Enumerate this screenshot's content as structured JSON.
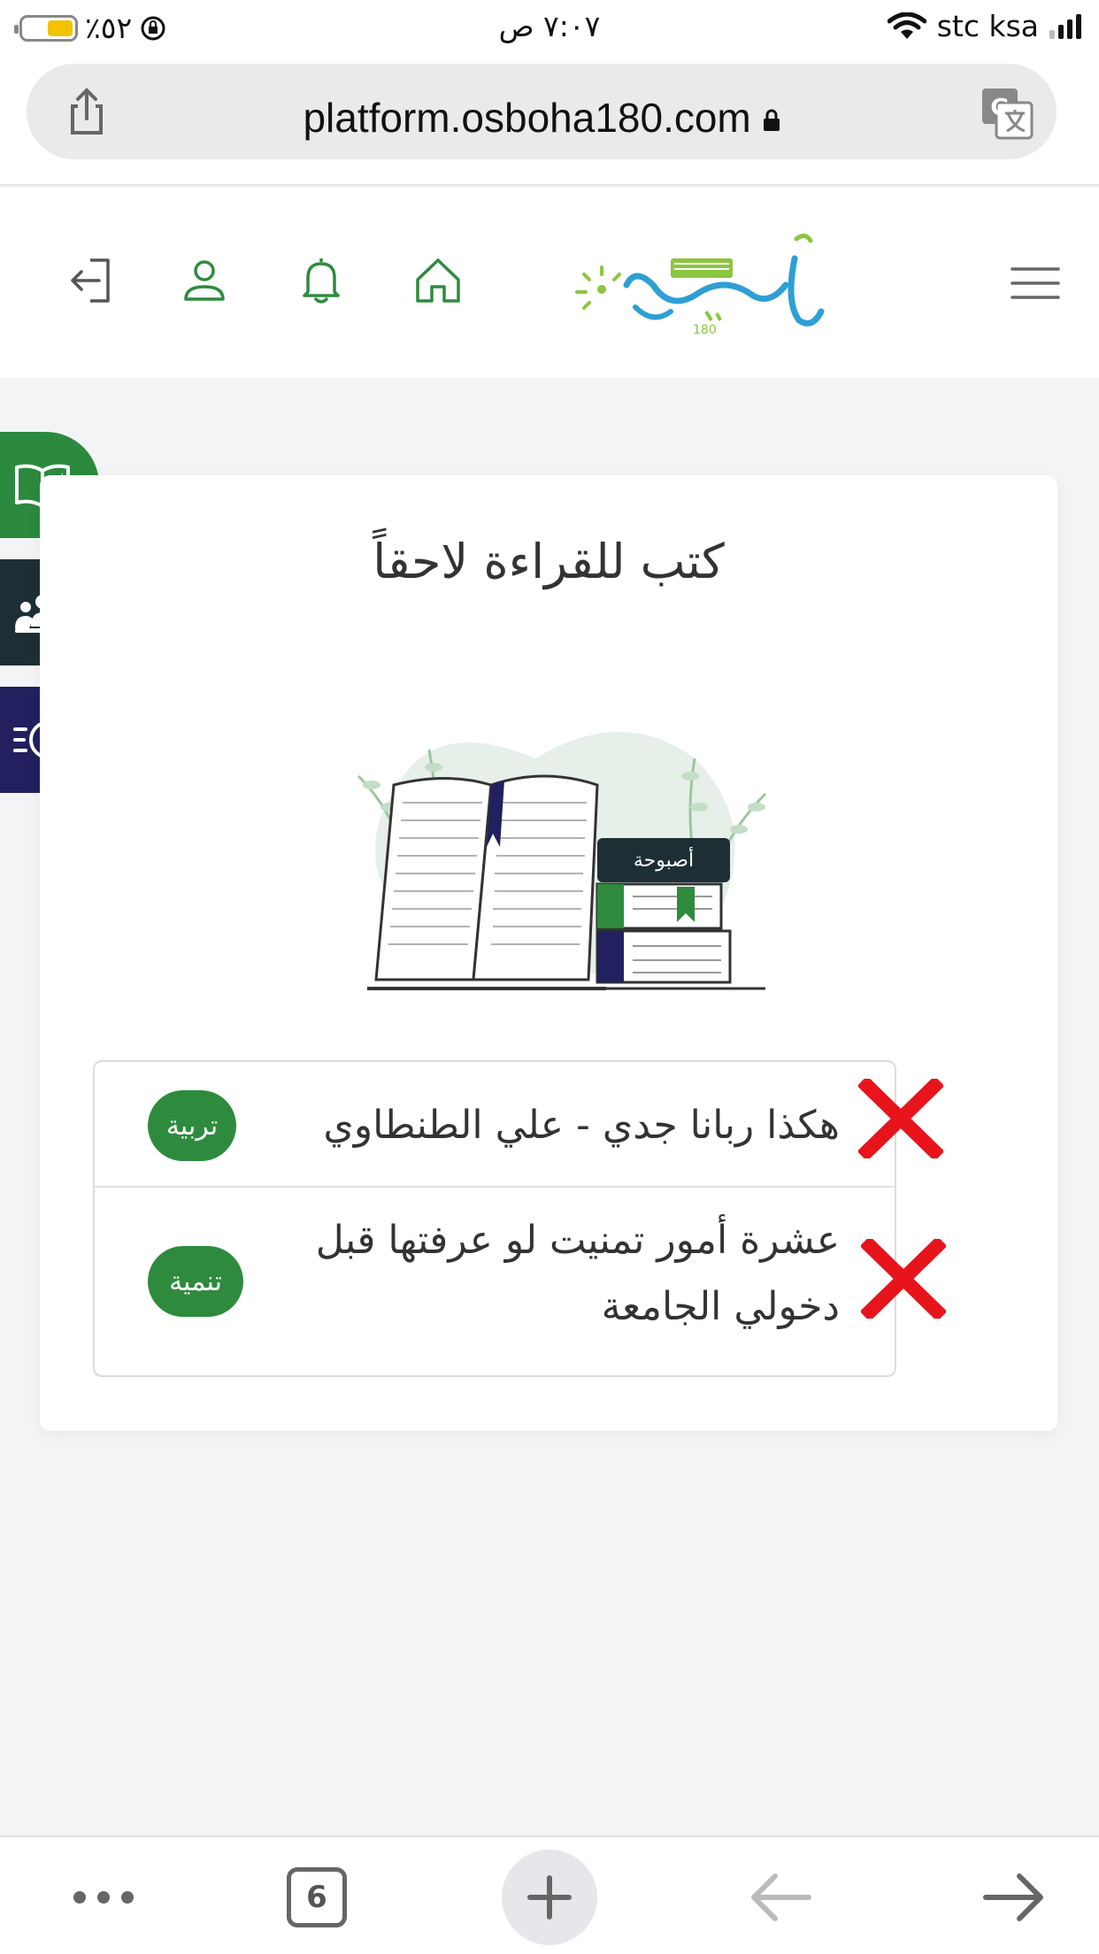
{
  "status_bar": {
    "battery": "٪٥٢",
    "time": "٧:٠٧ ص",
    "carrier": "stc ksa"
  },
  "browser": {
    "url": "platform.osboha180.com",
    "open_tabs": "6"
  },
  "app": {
    "logo_text": "أصبوحة"
  },
  "card": {
    "title": "كتب للقراءة لاحقاً",
    "books": [
      {
        "title": "هكذا ربانا جدي - علي الطنطاوي",
        "category": "تربية"
      },
      {
        "title_line1": "عشرة أمور تمنيت لو عرفتها قبل",
        "title_line2": "دخولي الجامعة",
        "category": "تنمية"
      }
    ]
  },
  "colors": {
    "brand_green": "#2e8b3d",
    "side_green": "#2b8a3e",
    "side_dark": "#1d2f35",
    "side_navy": "#22205e",
    "remove_red": "#e8141b"
  },
  "icons": {
    "header": [
      "logout-icon",
      "user-icon",
      "bell-icon",
      "home-icon",
      "menu-icon"
    ],
    "side": [
      "book-icon",
      "group-icon",
      "history-icon"
    ],
    "toolbar": [
      "more-icon",
      "tabs-icon",
      "plus-icon",
      "back-arrow-icon",
      "forward-arrow-icon"
    ]
  }
}
